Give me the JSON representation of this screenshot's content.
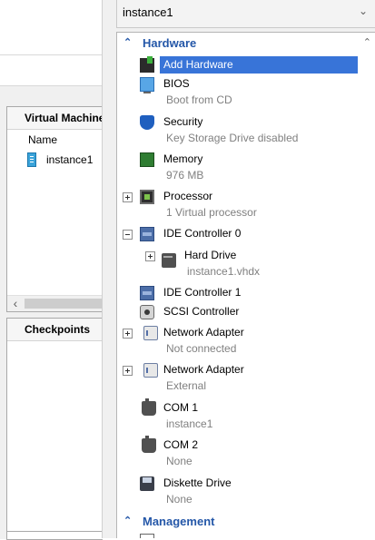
{
  "background": {
    "vm_panel_title": "Virtual Machines",
    "name_column": "Name",
    "vm_name": "instance1",
    "checkpoints_title": "Checkpoints"
  },
  "dialog": {
    "vm_selector_value": "instance1",
    "hardware_section": "Hardware",
    "management_section": "Management",
    "items": {
      "add_hardware": {
        "title": "Add Hardware"
      },
      "bios": {
        "title": "BIOS",
        "sub": "Boot from CD"
      },
      "security": {
        "title": "Security",
        "sub": "Key Storage Drive disabled"
      },
      "memory": {
        "title": "Memory",
        "sub": "976 MB"
      },
      "processor": {
        "title": "Processor",
        "sub": "1 Virtual processor"
      },
      "ide0": {
        "title": "IDE Controller 0"
      },
      "hard_drive": {
        "title": "Hard Drive",
        "sub": "instance1.vhdx"
      },
      "ide1": {
        "title": "IDE Controller 1"
      },
      "scsi": {
        "title": "SCSI Controller"
      },
      "net1": {
        "title": "Network Adapter",
        "sub": "Not connected"
      },
      "net2": {
        "title": "Network Adapter",
        "sub": "External"
      },
      "com1": {
        "title": "COM 1",
        "sub": "instance1"
      },
      "com2": {
        "title": "COM 2",
        "sub": "None"
      },
      "diskette": {
        "title": "Diskette Drive",
        "sub": "None"
      }
    }
  },
  "colors": {
    "section_header": "#2457a8",
    "selection": "#3874d8",
    "sub_text": "#808080"
  }
}
